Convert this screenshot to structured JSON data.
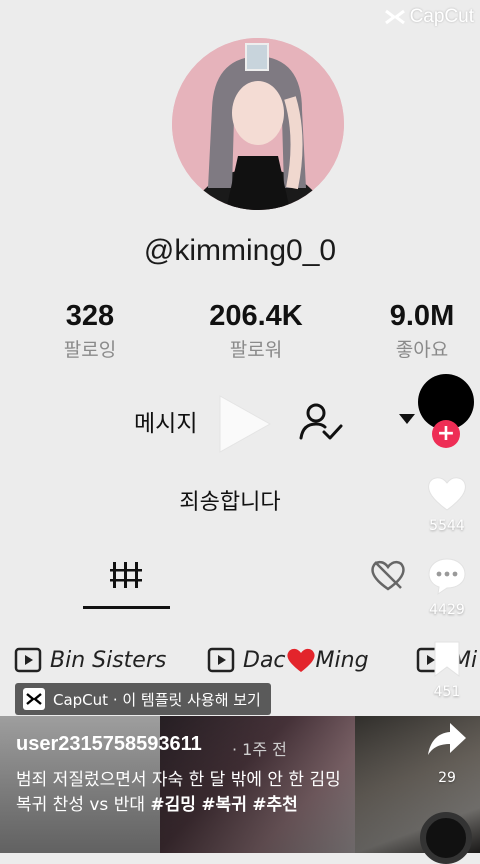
{
  "watermark": {
    "label": "CapCut"
  },
  "profile": {
    "handle": "@kimming0_0",
    "stats": [
      {
        "value": "328",
        "label": "팔로잉"
      },
      {
        "value": "206.4K",
        "label": "팔로워"
      },
      {
        "value": "9.0M",
        "label": "좋아요"
      }
    ],
    "message_button": "메시지",
    "apology_text": "죄송합니다"
  },
  "playlists": [
    {
      "name": "Bin Sisters"
    },
    {
      "name_prefix": "Dac",
      "name_suffix": "Ming"
    },
    {
      "name": "Mi"
    }
  ],
  "capcut_chip": {
    "label": "CapCut · 이 템플릿 사용해 보기"
  },
  "video": {
    "username": "user2315758593611",
    "time_ago": "· 1주 전",
    "caption_text": "범죄 저질렀으면서 자숙 한 달 밖에 안 한 김밍 복귀 찬성 vs 반대",
    "hashtags": [
      "#김밍",
      "#복귀",
      "#추천"
    ]
  },
  "actions": {
    "likes": "5544",
    "comments": "4429",
    "saves": "451",
    "shares": "29"
  },
  "colors": {
    "like_badge": "#ee2d55",
    "background": "#ececec"
  }
}
